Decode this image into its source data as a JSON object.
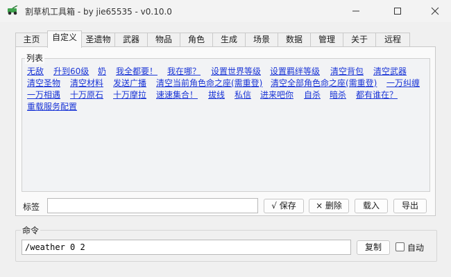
{
  "window": {
    "title": "割草机工具箱  - by jie65535  - v0.10.0",
    "accent_color": "#1a35d6"
  },
  "tabs": [
    {
      "label": "主页",
      "active": false
    },
    {
      "label": "自定义",
      "active": true
    },
    {
      "label": "圣遗物",
      "active": false
    },
    {
      "label": "武器",
      "active": false
    },
    {
      "label": "物品",
      "active": false
    },
    {
      "label": "角色",
      "active": false
    },
    {
      "label": "生成",
      "active": false
    },
    {
      "label": "场景",
      "active": false
    },
    {
      "label": "数据",
      "active": false
    },
    {
      "label": "管理",
      "active": false
    },
    {
      "label": "关于",
      "active": false
    },
    {
      "label": "远程",
      "active": false
    }
  ],
  "custom": {
    "list_title": "列表",
    "commands": [
      [
        "无敌",
        "升到60级",
        "奶",
        "我全都要！",
        "我在哪？",
        "设置世界等级",
        "设置羁绊等级",
        "清空背包",
        "清空武器"
      ],
      [
        "清空圣物",
        "清空材料",
        "发送广播",
        "清空当前角色命之座(需重登)",
        "清空全部角色命之座(需重登)",
        "一万纠缠"
      ],
      [
        "一万相遇",
        "十万原石",
        "十万摩拉",
        "速速集合！",
        "拔线",
        "私信",
        "进来吧你",
        "自杀",
        "暗杀",
        "都有谁在？"
      ],
      [
        "重载服务配置"
      ]
    ],
    "tag_label": "标签",
    "tag_value": "",
    "save_button": "√ 保存",
    "delete_button": "× 删除",
    "load_button": "载入",
    "export_button": "导出"
  },
  "command": {
    "title": "命令",
    "value": "/weather 0 2",
    "copy_button": "复制",
    "auto_label": "自动",
    "auto_checked": false
  }
}
